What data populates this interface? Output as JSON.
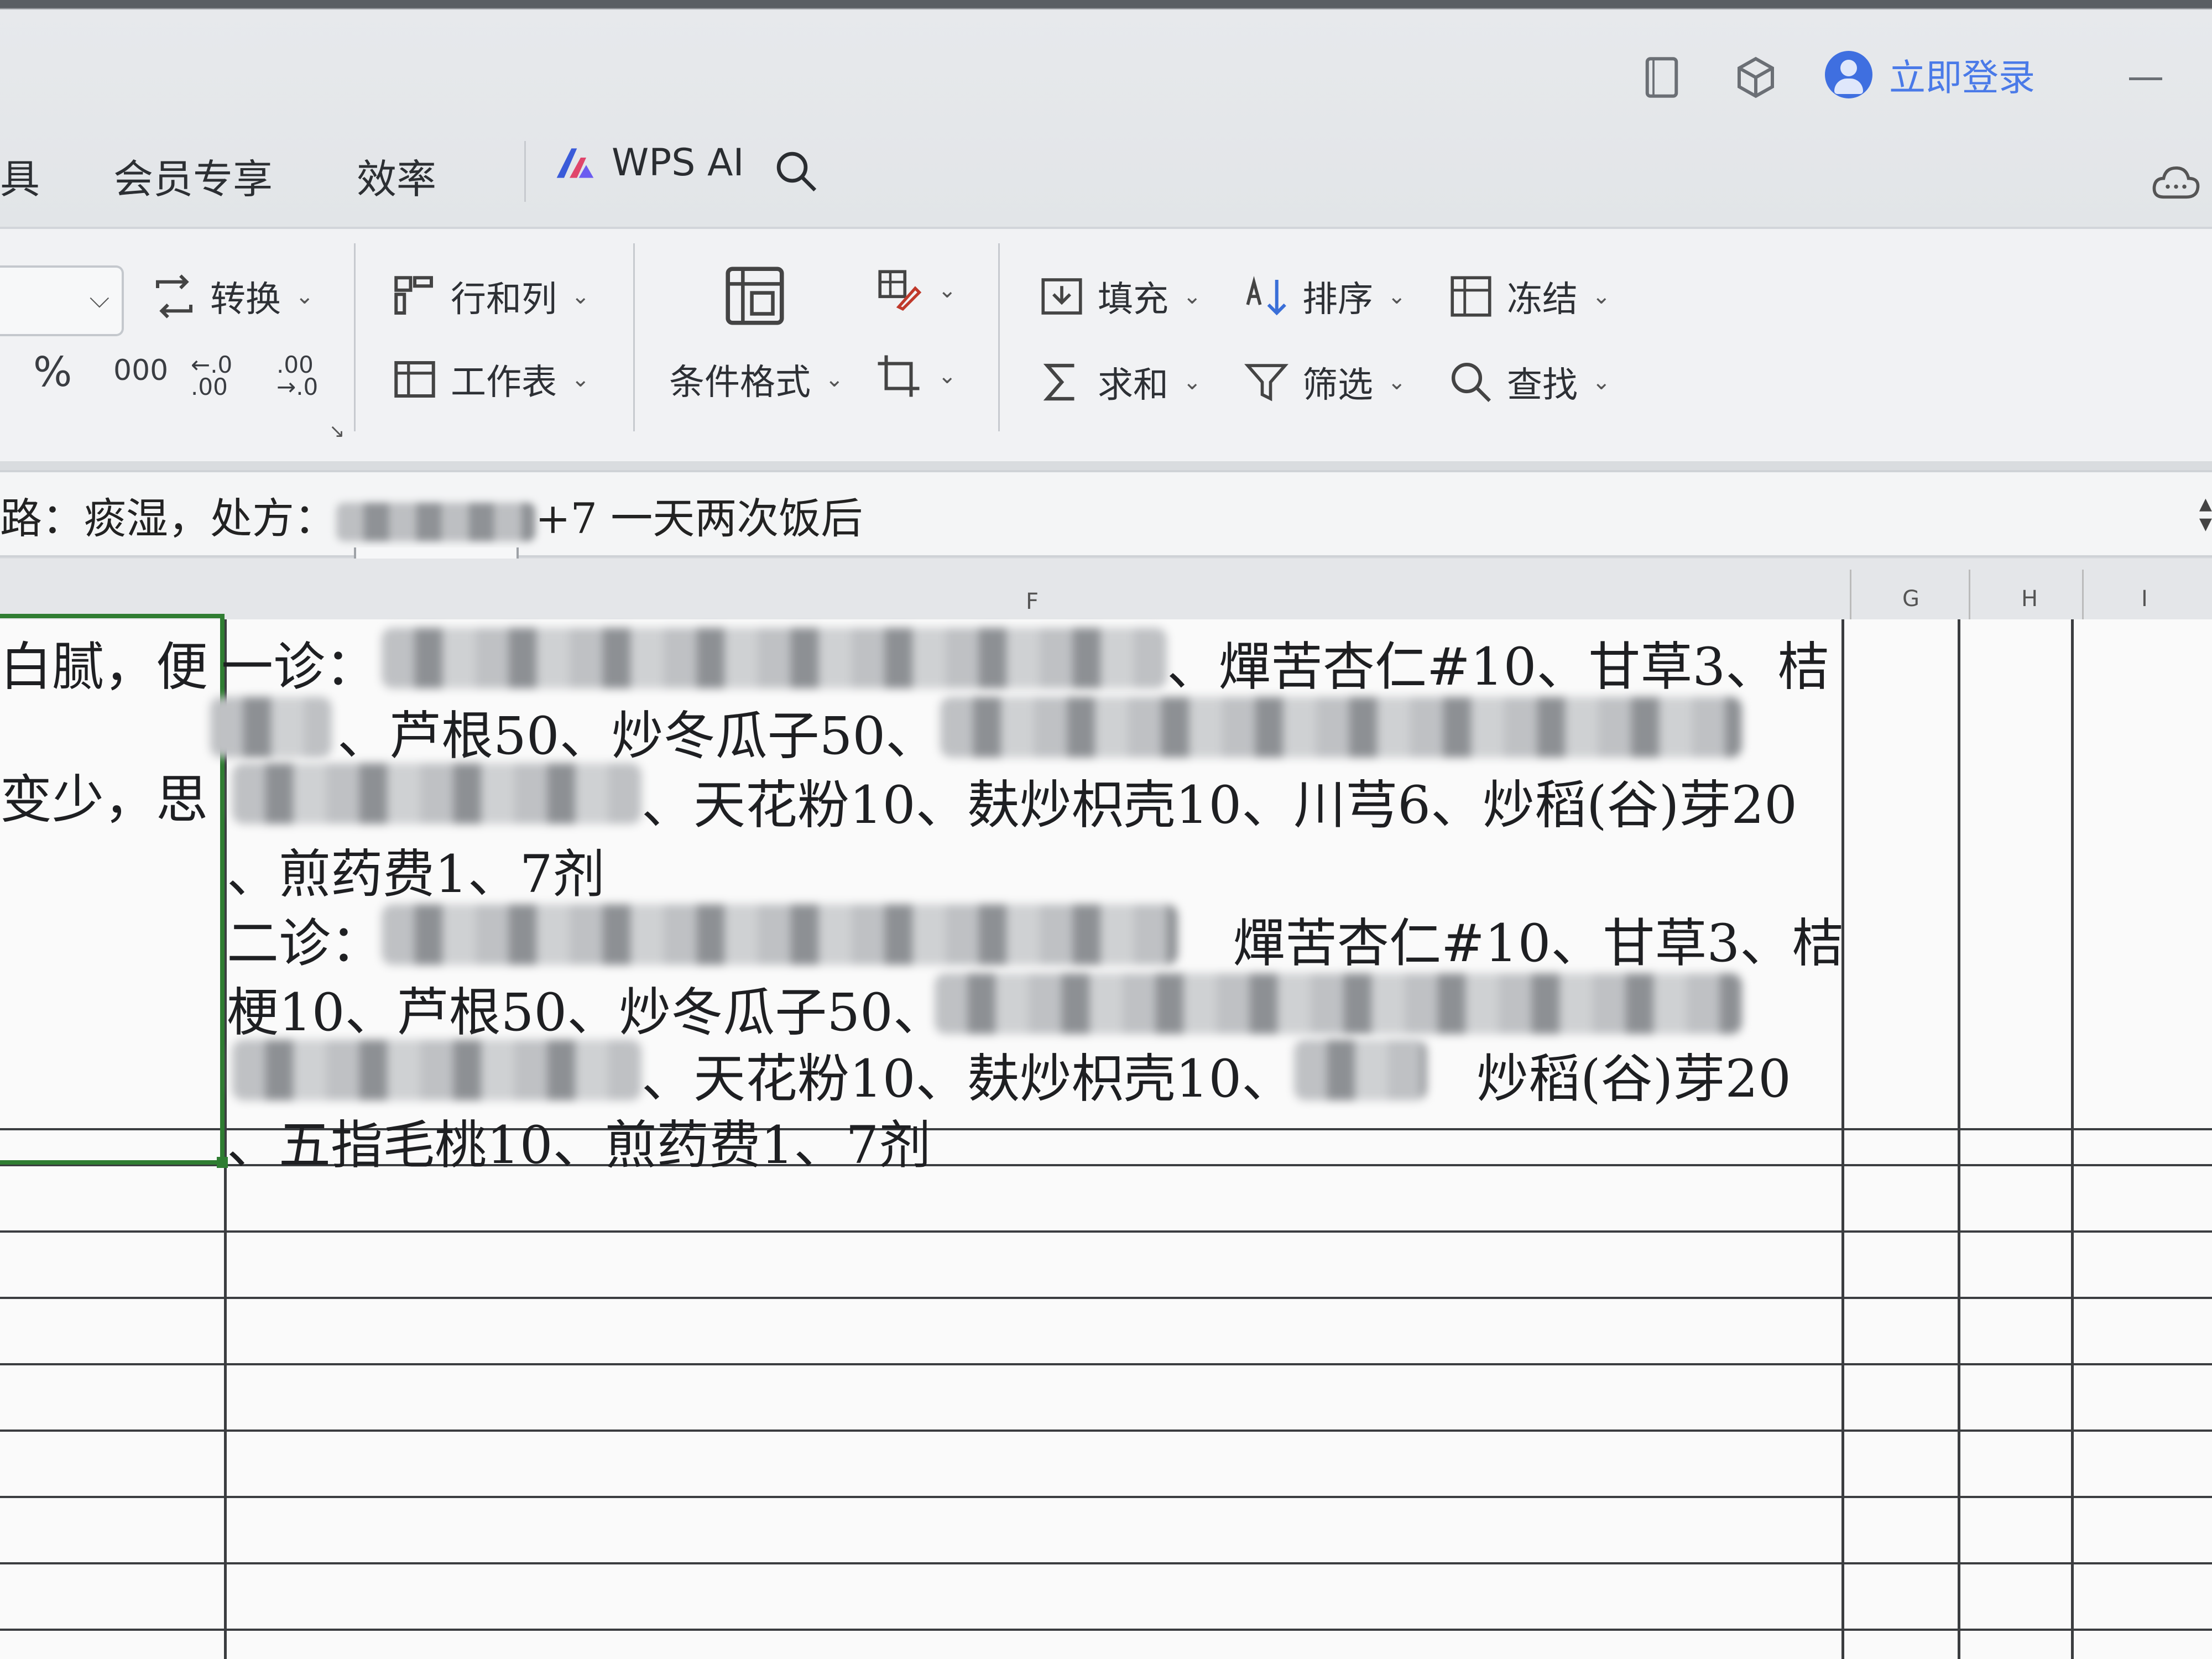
{
  "titlebar": {
    "login_label": "立即登录"
  },
  "menu": {
    "items": [
      "具",
      "会员专享",
      "效率"
    ],
    "wps_ai": "WPS AI"
  },
  "ribbon": {
    "convert": "转换",
    "rows_cols": "行和列",
    "worksheet": "工作表",
    "conditional_format": "条件格式",
    "fill": "填充",
    "sort": "排序",
    "freeze": "冻结",
    "sum": "求和",
    "filter": "筛选",
    "find": "查找",
    "percent": "%",
    "thousands": "000",
    "inc_decimal": "←.0 .00",
    "dec_decimal": ".00 →.0"
  },
  "formula_bar": {
    "text_prefix": "路：痰湿，处方：",
    "text_suffix": "+7  一天两次饭后"
  },
  "columns": [
    "F",
    "G",
    "H",
    "I"
  ],
  "cells": {
    "left_col": [
      "白腻，便",
      "变少，思"
    ],
    "main_lines": [
      {
        "prefix": "一诊：",
        "text": "、燀苦杏仁#10、甘草3、桔"
      },
      {
        "prefix": "",
        "text": "、芦根50、炒冬瓜子50、"
      },
      {
        "prefix": "",
        "text": "、天花粉10、麸炒枳壳10、川芎6、炒稻(谷)芽20"
      },
      {
        "prefix": "",
        "text": "、煎药费1、7剂"
      },
      {
        "prefix": "二诊：",
        "text": "燀苦杏仁#10、甘草3、桔"
      },
      {
        "prefix": "",
        "text": "梗10、芦根50、炒冬瓜子50、"
      },
      {
        "prefix": "",
        "text": "、天花粉10、麸炒枳壳10、"
      },
      {
        "prefix": "",
        "text": "炒稻(谷)芽20"
      },
      {
        "prefix": "",
        "text": "、五指毛桃10、煎药费1、7剂"
      }
    ]
  },
  "colors": {
    "selection": "#2f7d32",
    "accent": "#4a7ae8"
  }
}
